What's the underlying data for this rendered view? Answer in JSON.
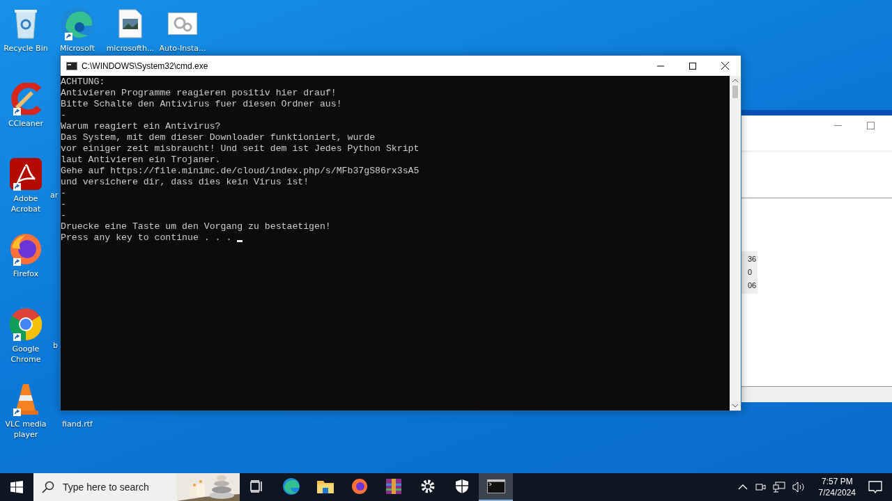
{
  "desktop_icons": [
    {
      "label": "Recycle Bin",
      "shortcut": false
    },
    {
      "label": "Microsoft",
      "shortcut": true
    },
    {
      "label": "microsofth...",
      "shortcut": false
    },
    {
      "label": "Auto-Insta...",
      "shortcut": false
    },
    {
      "label": "CCleaner",
      "shortcut": true
    },
    {
      "label": "Adobe Acrobat",
      "shortcut": true
    },
    {
      "label": "Firefox",
      "shortcut": true
    },
    {
      "label": "Google Chrome",
      "shortcut": true
    },
    {
      "label": "VLC media player",
      "shortcut": true
    },
    {
      "label": "fiand.rtf",
      "shortcut": false
    }
  ],
  "hidden_icon_labels": [
    "ar",
    "b"
  ],
  "background_window": {
    "column_values": [
      "36",
      "0",
      "06"
    ]
  },
  "console_window": {
    "title": "C:\\WINDOWS\\System32\\cmd.exe",
    "cursor": true,
    "lines": [
      "ACHTUNG:",
      "Antivieren Programme reagieren positiv hier drauf!",
      "Bitte Schalte den Antivirus fuer diesen Ordner aus!",
      "-",
      "Warum reagiert ein Antivirus?",
      "Das System, mit dem dieser Downloader funktioniert, wurde",
      "vor einiger zeit misbraucht! Und seit dem ist Jedes Python Skript",
      "laut Antivieren ein Trojaner.",
      "Gehe auf https://file.minimc.de/cloud/index.php/s/MFb37gS86rx3sA5",
      "und versichere dir, dass dies kein Virus ist!",
      "-",
      "-",
      "-",
      "Druecke eine Taste um den Vorgang zu bestaetigen!",
      "Press any key to continue . . . "
    ]
  },
  "taskbar": {
    "search": {
      "placeholder": "Type here to search"
    },
    "apps": [
      {
        "selected": false
      },
      {
        "selected": false
      },
      {
        "selected": false
      },
      {
        "selected": false
      },
      {
        "selected": false
      },
      {
        "selected": false
      },
      {
        "selected": false
      },
      {
        "selected": true
      }
    ],
    "clock": {
      "time": "7:57 PM",
      "date": "7/24/2024"
    }
  }
}
